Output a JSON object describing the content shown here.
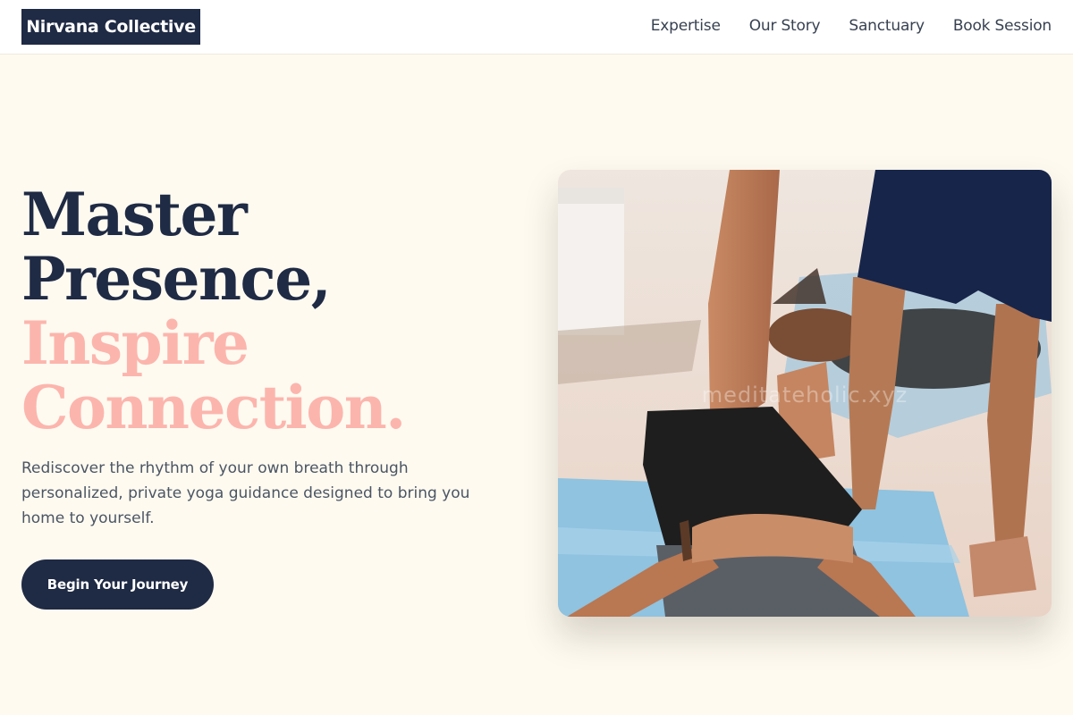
{
  "brand": {
    "name": "Nirvana Collective"
  },
  "nav": {
    "items": [
      "Expertise",
      "Our Story",
      "Sanctuary",
      "Book Session"
    ]
  },
  "hero": {
    "title_line1": "Master",
    "title_line2": "Presence,",
    "accent_line1": "Inspire",
    "accent_line2": "Connection.",
    "description": "Rediscover the rhythm of your own breath through personalized, private yoga guidance designed to bring you home to yourself.",
    "cta_label": "Begin Your Journey",
    "image_watermark": "meditateholic.xyz"
  },
  "colors": {
    "navy": "#1f2a44",
    "accent_pink": "#fcb5ad",
    "cream_background": "#fefaf0"
  }
}
